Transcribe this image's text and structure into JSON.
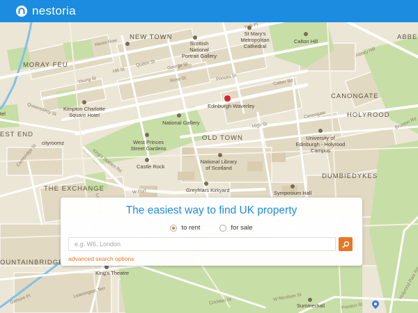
{
  "header": {
    "logo_text": "nestoria",
    "logo_icon": "house-arch-icon",
    "bg_color": "#1b8ce0"
  },
  "search": {
    "title": "The easiest way to find UK property",
    "options": [
      {
        "label": "to rent",
        "selected": true
      },
      {
        "label": "for sale",
        "selected": false
      }
    ],
    "placeholder": "e.g. W6, London",
    "value": "",
    "button_icon": "search-icon",
    "advanced_link": "advanced search options",
    "accent_color": "#e87722"
  },
  "map": {
    "districts": [
      "NEW TOWN",
      "MORAY FEU",
      "CANONGATE",
      "HOLYROOD",
      "ABBE",
      "OLD TOWN",
      "EST END",
      "THE EXCHANGE",
      "DUMBIEDYKES",
      "OUNTAINBRIDGE"
    ],
    "places": [
      "Scottish National Portrait Gallery",
      "St Mary's Metropolitan Cathedral",
      "Calton Hill",
      "Kimpton Charlotte Square Hotel",
      "Edinburgh Waverley",
      "National Gallery",
      "West Princes Street Gardens",
      "University of Edinburgh - Holyrood Campus",
      "Castle Rock",
      "National Library of Scotland",
      "Greyfriars Kirkyard",
      "Symposium Hall",
      "cityroomz",
      "King's Theatre",
      "Summerhall",
      "tel"
    ],
    "streets": [
      "Heriot Row",
      "Hill St",
      "Young St",
      "George St",
      "Rose St",
      "Princes St",
      "Queen St",
      "York Pl",
      "Calton Rd",
      "High St",
      "Canongate",
      "Queensferry St",
      "King's Stables Rd",
      "W Port",
      "Cambridge St",
      "Lothian Rd",
      "Holyrood Park Rd",
      "Preston St",
      "W Nicolson St",
      "Gilmore Pl",
      "Leamington Terr",
      "Crichton St",
      "Abbey Hill",
      "Brunton Rd"
    ]
  }
}
